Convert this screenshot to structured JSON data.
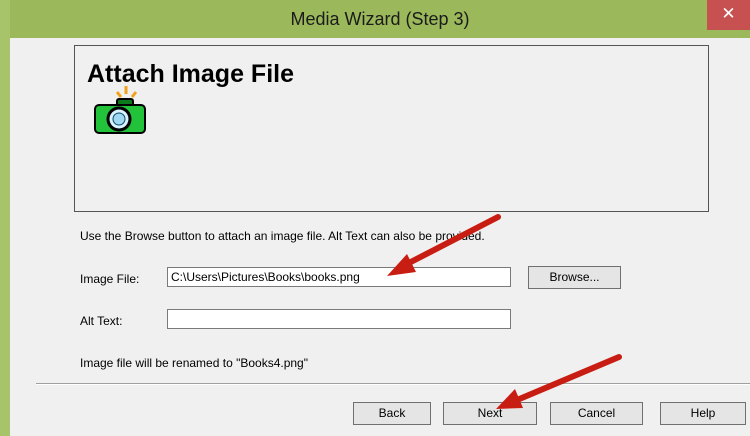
{
  "window": {
    "title": "Media Wizard (Step 3)",
    "close_glyph": "✕",
    "close_color": "#c75050",
    "titlebar_color": "#9bb95b"
  },
  "header": {
    "title": "Attach Image File",
    "icon": "camera-flash-icon"
  },
  "instructions": "Use the Browse button to attach an image file.  Alt Text can also be provided.",
  "image_file": {
    "label": "Image File:",
    "value": "C:\\Users\\Pictures\\Books\\books.png"
  },
  "browse_label": "Browse...",
  "alt_text": {
    "label": "Alt Text:",
    "value": ""
  },
  "rename_note": "Image file will be renamed to \"Books4.png\"",
  "buttons": {
    "back": "Back",
    "next": "Next",
    "cancel": "Cancel",
    "help": "Help"
  },
  "annotation_color": "#c81d12"
}
